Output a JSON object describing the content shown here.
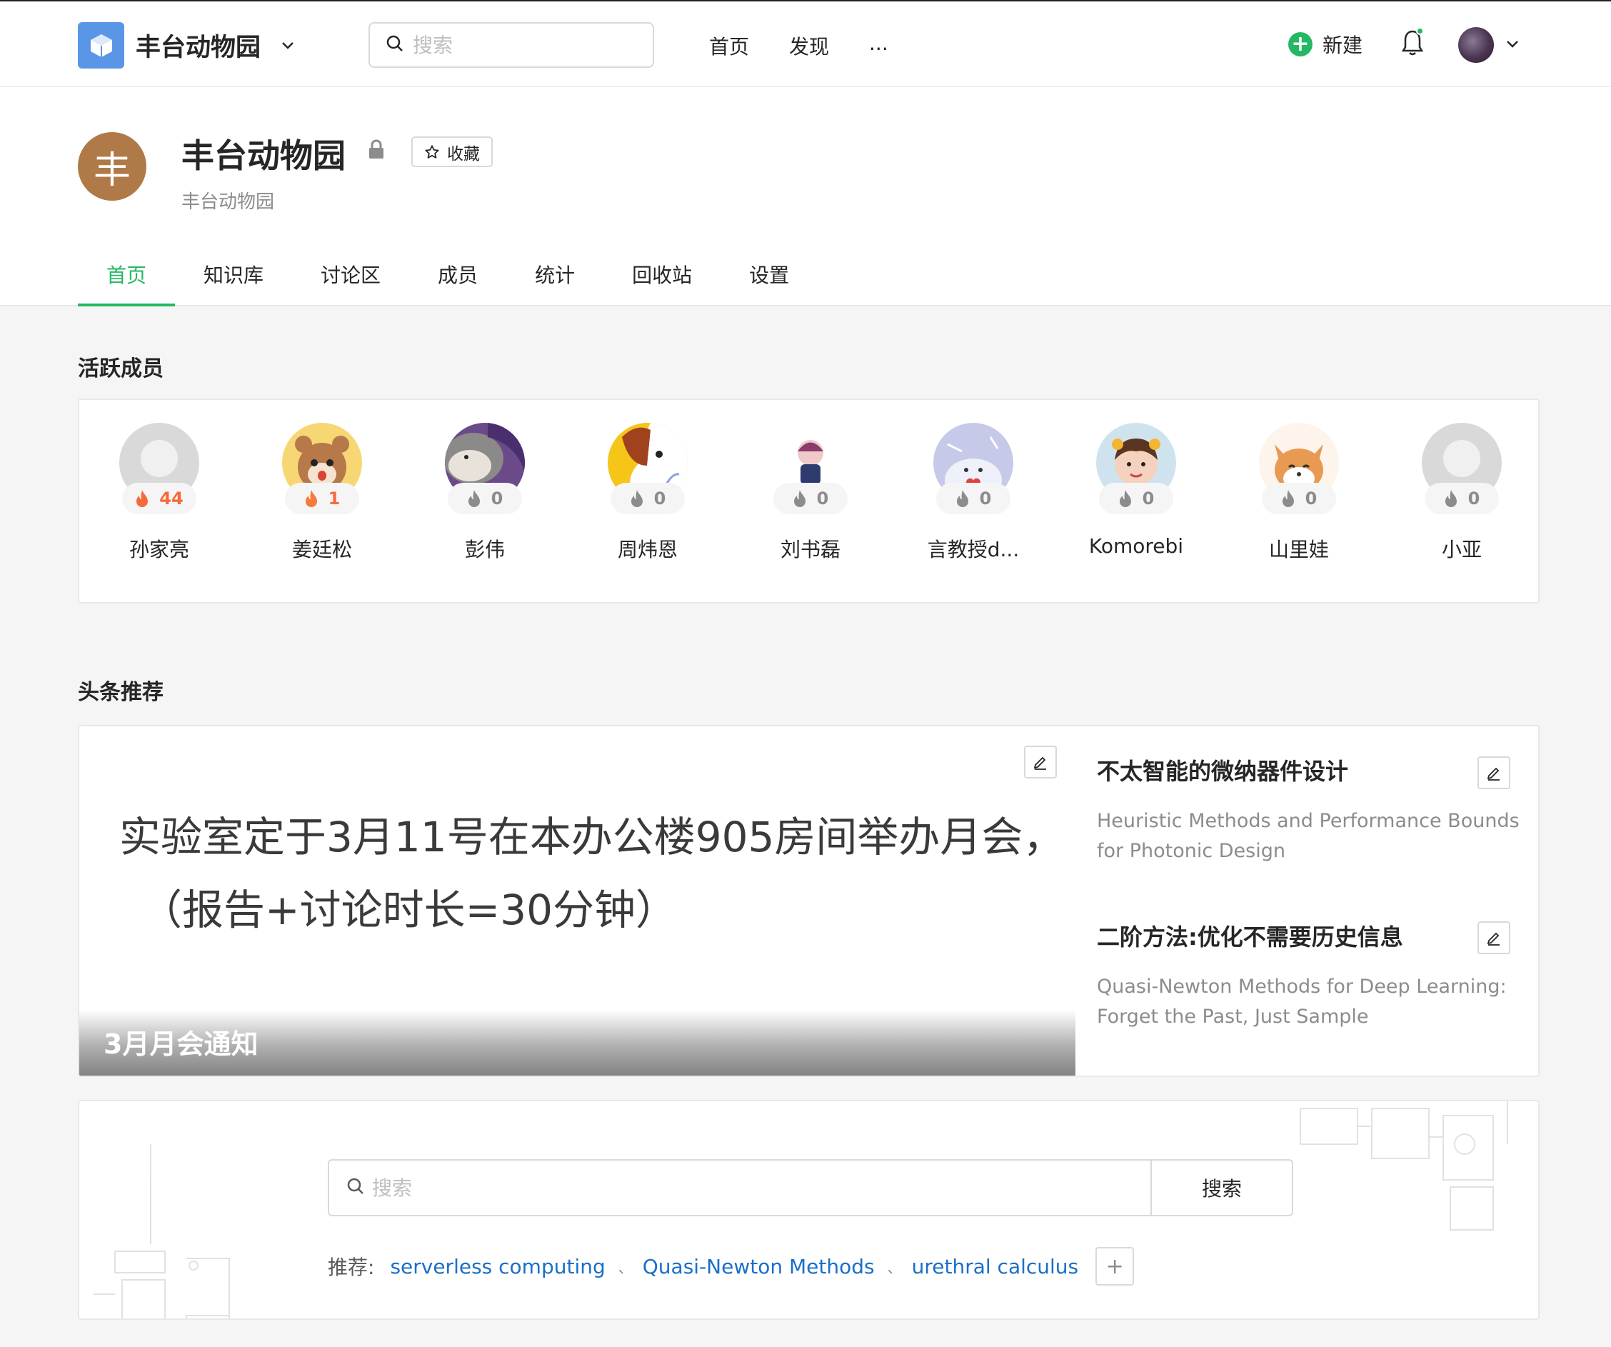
{
  "topbar": {
    "org_name": "丰台动物园",
    "search_placeholder": "搜索",
    "nav": [
      "首页",
      "发现",
      "..."
    ],
    "new_label": "新建"
  },
  "group": {
    "avatar_char": "丰",
    "title": "丰台动物园",
    "favorite_label": "收藏",
    "subtitle": "丰台动物园",
    "tabs": [
      "首页",
      "知识库",
      "讨论区",
      "成员",
      "统计",
      "回收站",
      "设置"
    ],
    "active_tab": "首页",
    "accent_color": "#25b864"
  },
  "active_members": {
    "title": "活跃成员",
    "members": [
      {
        "name": "孙家亮",
        "score": "44",
        "hot": true,
        "avatar": "default-silhouette"
      },
      {
        "name": "姜廷松",
        "score": "1",
        "hot": true,
        "avatar": "cartoon-bear"
      },
      {
        "name": "彭伟",
        "score": "0",
        "hot": false,
        "avatar": "cat-photo"
      },
      {
        "name": "周炜恩",
        "score": "0",
        "hot": false,
        "avatar": "cartoon-dog"
      },
      {
        "name": "刘书磊",
        "score": "0",
        "hot": false,
        "avatar": "figurine"
      },
      {
        "name": "言教授d...",
        "score": "0",
        "hot": false,
        "avatar": "cartoon-animal"
      },
      {
        "name": "Komorebi",
        "score": "0",
        "hot": false,
        "avatar": "girl-photo"
      },
      {
        "name": "山里娃",
        "score": "0",
        "hot": false,
        "avatar": "shiba-dog"
      },
      {
        "name": "小亚",
        "score": "0",
        "hot": false,
        "avatar": "default-silhouette"
      }
    ]
  },
  "headlines": {
    "title": "头条推荐",
    "feature": {
      "line1": "实验室定于3月11号在本办公楼905房间举办月会，",
      "line2": "（报告+讨论时长=30分钟）",
      "caption": "3月月会通知"
    },
    "side_items": [
      {
        "title": "不太智能的微纳器件设计",
        "desc": "Heuristic Methods and Performance Bounds for Photonic Design"
      },
      {
        "title": "二阶方法:优化不需要历史信息",
        "desc": "Quasi-Newton Methods for Deep Learning: Forget the Past, Just Sample"
      }
    ]
  },
  "search_section": {
    "placeholder": "搜索",
    "button_label": "搜索",
    "recommend_label": "推荐:",
    "recommendations": [
      "serverless computing",
      "Quasi-Newton Methods",
      "urethral calculus"
    ],
    "separator": "、",
    "add_label": "+"
  }
}
